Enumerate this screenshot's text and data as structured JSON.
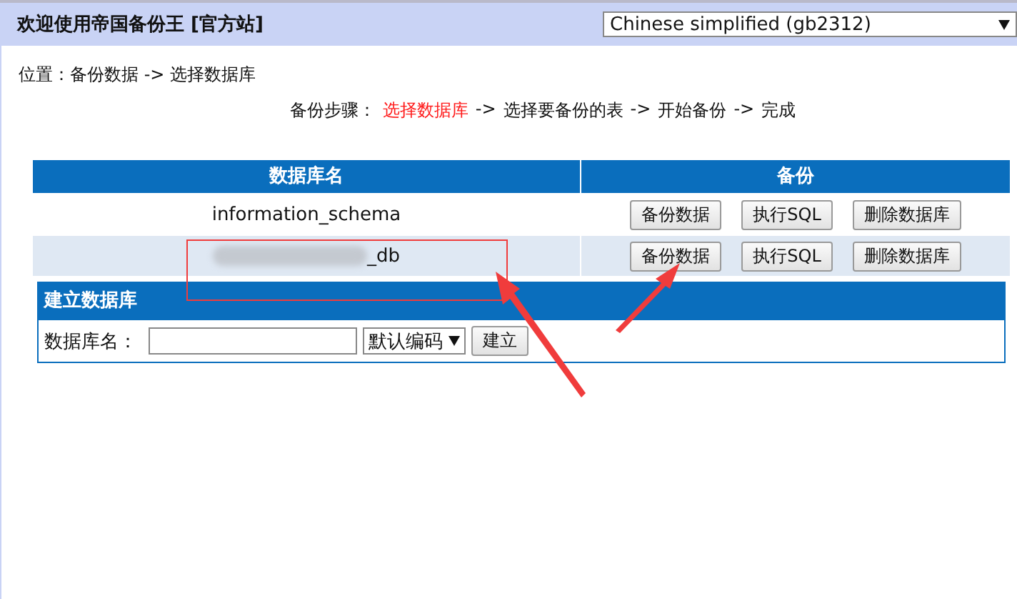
{
  "header": {
    "title": "欢迎使用帝国备份王 [官方站]",
    "language": "Chinese simplified (gb2312)"
  },
  "breadcrumb": "位置：备份数据 -> 选择数据库",
  "steps": [
    {
      "kind": "label",
      "text": "备份步骤："
    },
    {
      "kind": "step",
      "text": "选择数据库",
      "selected": true
    },
    {
      "kind": "arrow",
      "text": "->"
    },
    {
      "kind": "step",
      "text": "选择要备份的表",
      "selected": false
    },
    {
      "kind": "arrow",
      "text": "->"
    },
    {
      "kind": "step",
      "text": "开始备份",
      "selected": false
    },
    {
      "kind": "arrow",
      "text": "->"
    },
    {
      "kind": "step",
      "text": "完成",
      "selected": false
    }
  ],
  "table": {
    "columns": [
      "数据库名",
      "备份"
    ],
    "rows": [
      {
        "name": "information_schema",
        "blurred": false,
        "actions": [
          "备份数据",
          "执行SQL",
          "删除数据库"
        ]
      },
      {
        "name": "_db",
        "blurred": true,
        "actions": [
          "备份数据",
          "执行SQL",
          "删除数据库"
        ]
      }
    ]
  },
  "create": {
    "title": "建立数据库",
    "label": "数据库名：",
    "encoding": "默认编码",
    "button": "建立"
  }
}
